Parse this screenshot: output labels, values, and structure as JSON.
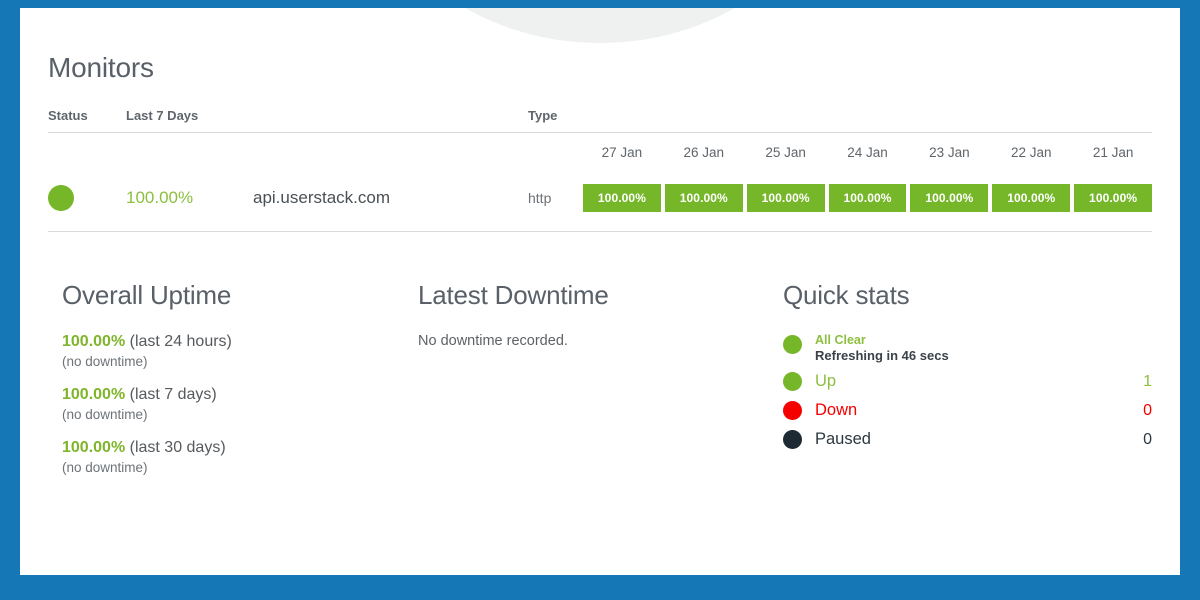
{
  "theme": {
    "frame_color": "#1577b5",
    "accent_green": "#76b72a",
    "text_green": "#8dbf3f",
    "danger_red": "#f40000",
    "paused_dark": "#1d2a33",
    "heading_gray": "#5a6067"
  },
  "monitors_section": {
    "title": "Monitors",
    "columns": {
      "status": "Status",
      "last7days": "Last 7 Days",
      "type": "Type"
    },
    "dates": [
      "27 Jan",
      "26 Jan",
      "25 Jan",
      "24 Jan",
      "23 Jan",
      "22 Jan",
      "21 Jan"
    ],
    "rows": [
      {
        "status": "up",
        "status_color": "#76b72a",
        "uptime": "100.00%",
        "name": "api.userstack.com",
        "type": "http",
        "daily": [
          {
            "label": "100.00%",
            "value": 100.0,
            "color": "#76b72a"
          },
          {
            "label": "100.00%",
            "value": 100.0,
            "color": "#76b72a"
          },
          {
            "label": "100.00%",
            "value": 100.0,
            "color": "#76b72a"
          },
          {
            "label": "100.00%",
            "value": 100.0,
            "color": "#76b72a"
          },
          {
            "label": "100.00%",
            "value": 100.0,
            "color": "#76b72a"
          },
          {
            "label": "100.00%",
            "value": 100.0,
            "color": "#76b72a"
          },
          {
            "label": "100.00%",
            "value": 100.0,
            "color": "#76b72a"
          }
        ]
      }
    ]
  },
  "overall_uptime": {
    "title": "Overall Uptime",
    "entries": [
      {
        "percent": "100.00%",
        "period": " (last 24 hours)",
        "note": "(no downtime)"
      },
      {
        "percent": "100.00%",
        "period": " (last 7 days)",
        "note": "(no downtime)"
      },
      {
        "percent": "100.00%",
        "period": " (last 30 days)",
        "note": "(no downtime)"
      }
    ]
  },
  "latest_downtime": {
    "title": "Latest Downtime",
    "empty_message": "No downtime recorded."
  },
  "quick_stats": {
    "title": "Quick stats",
    "all_clear": "All Clear",
    "refreshing": "Refreshing in 46 secs",
    "rows": [
      {
        "label": "Up",
        "value": "1"
      },
      {
        "label": "Down",
        "value": "0"
      },
      {
        "label": "Paused",
        "value": "0"
      }
    ]
  }
}
